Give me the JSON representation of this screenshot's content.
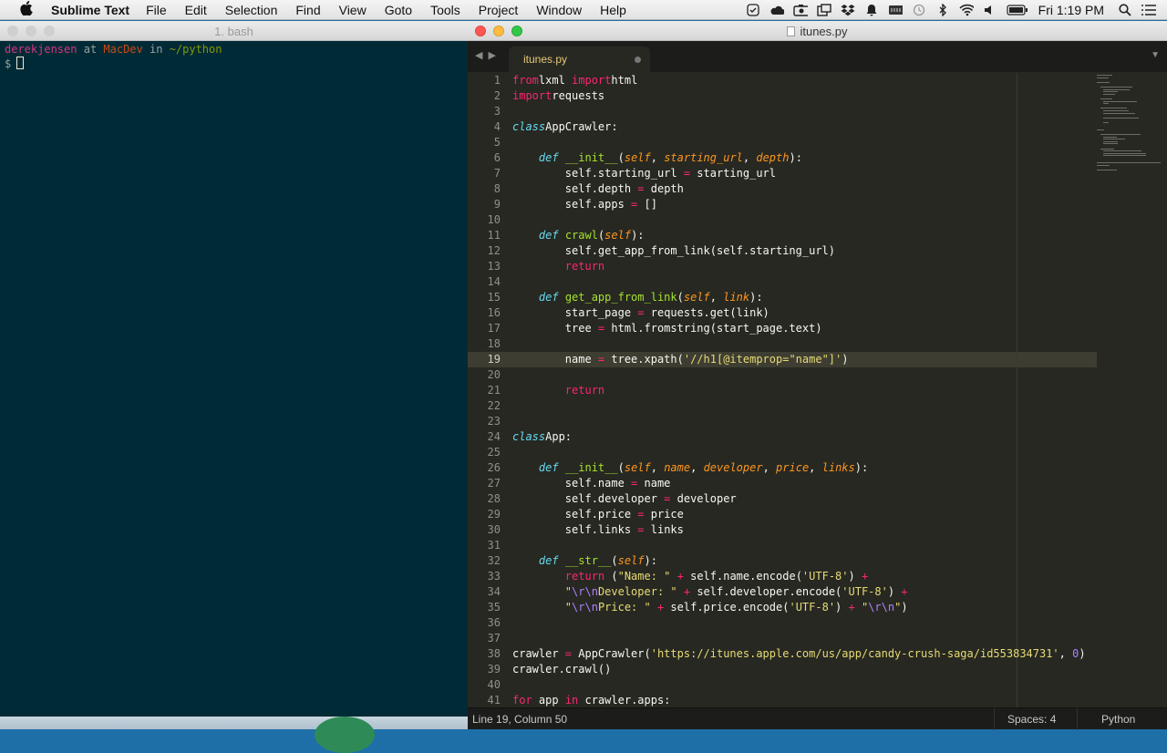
{
  "menubar": {
    "app_name": "Sublime Text",
    "items": [
      "File",
      "Edit",
      "Selection",
      "Find",
      "View",
      "Goto",
      "Tools",
      "Project",
      "Window",
      "Help"
    ],
    "clock": "Fri 1:19 PM",
    "status_icons": [
      "check-circle-icon",
      "cloud-icon",
      "camera-icon",
      "window-icon",
      "dropbox-icon",
      "bell-icon",
      "keyboard-icon",
      "time-machine-icon",
      "bluetooth-icon",
      "wifi-icon",
      "volume-icon",
      "battery-icon",
      "search-icon",
      "list-icon"
    ]
  },
  "terminal": {
    "title": "1. bash",
    "user": "derekjensen",
    "at": "at",
    "host": "MacDev",
    "in": "in",
    "path": "~/python",
    "prompt": "$"
  },
  "sublime": {
    "window_title": "itunes.py",
    "tab_label": "itunes.py",
    "active_line": 19,
    "line_count": 41,
    "status": {
      "position": "Line 19, Column 50",
      "spaces": "Spaces: 4",
      "syntax": "Python"
    },
    "code": [
      [
        [
          "kw",
          "from"
        ],
        [
          "",
          "lxml "
        ],
        [
          "kw",
          "import"
        ],
        [
          "",
          "html"
        ]
      ],
      [
        [
          "kw",
          "import"
        ],
        [
          "",
          "requests"
        ]
      ],
      [],
      [
        [
          "st",
          "class"
        ],
        [
          "",
          "AppCrawler:"
        ]
      ],
      [],
      [
        [
          "",
          "    "
        ],
        [
          "st",
          "def"
        ],
        [
          "",
          ""
        ],
        [
          "fn",
          "__init__"
        ],
        [
          "",
          "("
        ],
        [
          "pa",
          "self"
        ],
        [
          "",
          ", "
        ],
        [
          "pa",
          "starting_url"
        ],
        [
          "",
          ", "
        ],
        [
          "pa",
          "depth"
        ],
        [
          "",
          "):"
        ]
      ],
      [
        [
          "",
          "        self.starting_url "
        ],
        [
          "op",
          "="
        ],
        [
          "",
          " starting_url"
        ]
      ],
      [
        [
          "",
          "        self.depth "
        ],
        [
          "op",
          "="
        ],
        [
          "",
          " depth"
        ]
      ],
      [
        [
          "",
          "        self.apps "
        ],
        [
          "op",
          "="
        ],
        [
          "",
          " []"
        ]
      ],
      [],
      [
        [
          "",
          "    "
        ],
        [
          "st",
          "def"
        ],
        [
          "",
          ""
        ],
        [
          "fn",
          "crawl"
        ],
        [
          "",
          "("
        ],
        [
          "pa",
          "self"
        ],
        [
          "",
          "):"
        ]
      ],
      [
        [
          "",
          "        self.get_app_from_link(self.starting_url)"
        ]
      ],
      [
        [
          "",
          "        "
        ],
        [
          "kw",
          "return"
        ]
      ],
      [],
      [
        [
          "",
          "    "
        ],
        [
          "st",
          "def"
        ],
        [
          "",
          ""
        ],
        [
          "fn",
          "get_app_from_link"
        ],
        [
          "",
          "("
        ],
        [
          "pa",
          "self"
        ],
        [
          "",
          ", "
        ],
        [
          "pa",
          "link"
        ],
        [
          "",
          "):"
        ]
      ],
      [
        [
          "",
          "        start_page "
        ],
        [
          "op",
          "="
        ],
        [
          "",
          " requests.get(link)"
        ]
      ],
      [
        [
          "",
          "        tree "
        ],
        [
          "op",
          "="
        ],
        [
          "",
          " html.fromstring(start_page.text)"
        ]
      ],
      [],
      [
        [
          "",
          "        name "
        ],
        [
          "op",
          "="
        ],
        [
          "",
          " tree.xpath("
        ],
        [
          "str",
          "'//h1[@itemprop=\"name\"]'"
        ],
        [
          "",
          ")"
        ]
      ],
      [],
      [
        [
          "",
          "        "
        ],
        [
          "kw",
          "return"
        ]
      ],
      [],
      [],
      [
        [
          "st",
          "class"
        ],
        [
          "",
          "App:"
        ]
      ],
      [],
      [
        [
          "",
          "    "
        ],
        [
          "st",
          "def"
        ],
        [
          "",
          ""
        ],
        [
          "fn",
          "__init__"
        ],
        [
          "",
          "("
        ],
        [
          "pa",
          "self"
        ],
        [
          "",
          ", "
        ],
        [
          "pa",
          "name"
        ],
        [
          "",
          ", "
        ],
        [
          "pa",
          "developer"
        ],
        [
          "",
          ", "
        ],
        [
          "pa",
          "price"
        ],
        [
          "",
          ", "
        ],
        [
          "pa",
          "links"
        ],
        [
          "",
          "):"
        ]
      ],
      [
        [
          "",
          "        self.name "
        ],
        [
          "op",
          "="
        ],
        [
          "",
          " name"
        ]
      ],
      [
        [
          "",
          "        self.developer "
        ],
        [
          "op",
          "="
        ],
        [
          "",
          " developer"
        ]
      ],
      [
        [
          "",
          "        self.price "
        ],
        [
          "op",
          "="
        ],
        [
          "",
          " price"
        ]
      ],
      [
        [
          "",
          "        self.links "
        ],
        [
          "op",
          "="
        ],
        [
          "",
          " links"
        ]
      ],
      [],
      [
        [
          "",
          "    "
        ],
        [
          "st",
          "def"
        ],
        [
          "",
          ""
        ],
        [
          "fn",
          "__str__"
        ],
        [
          "",
          "("
        ],
        [
          "pa",
          "self"
        ],
        [
          "",
          "):"
        ]
      ],
      [
        [
          "",
          "        "
        ],
        [
          "kw",
          "return"
        ],
        [
          "",
          " ("
        ],
        [
          "str",
          "\"Name: \""
        ],
        [
          "op",
          " + "
        ],
        [
          "",
          "self.name.encode("
        ],
        [
          "str",
          "'UTF-8'"
        ],
        [
          "",
          ") "
        ],
        [
          "op",
          "+"
        ]
      ],
      [
        [
          "",
          "        "
        ],
        [
          "str",
          "\""
        ],
        [
          "se",
          "\\r\\n"
        ],
        [
          "str",
          "Developer: \""
        ],
        [
          "op",
          " + "
        ],
        [
          "",
          "self.developer.encode("
        ],
        [
          "str",
          "'UTF-8'"
        ],
        [
          "",
          ") "
        ],
        [
          "op",
          "+"
        ]
      ],
      [
        [
          "",
          "        "
        ],
        [
          "str",
          "\""
        ],
        [
          "se",
          "\\r\\n"
        ],
        [
          "str",
          "Price: \""
        ],
        [
          "op",
          " + "
        ],
        [
          "",
          "self.price.encode("
        ],
        [
          "str",
          "'UTF-8'"
        ],
        [
          "",
          ") "
        ],
        [
          "op",
          "+"
        ],
        [
          "",
          " "
        ],
        [
          "str",
          "\""
        ],
        [
          "se",
          "\\r\\n"
        ],
        [
          "str",
          "\""
        ],
        [
          "",
          ")"
        ]
      ],
      [],
      [],
      [
        [
          "",
          "crawler "
        ],
        [
          "op",
          "="
        ],
        [
          "",
          " AppCrawler("
        ],
        [
          "str",
          "'https://itunes.apple.com/us/app/candy-crush-saga/id553834731'"
        ],
        [
          "",
          ", "
        ],
        [
          "nu",
          "0"
        ],
        [
          "",
          ")"
        ]
      ],
      [
        [
          "",
          "crawler.crawl()"
        ]
      ],
      [],
      [
        [
          "kw",
          "for"
        ],
        [
          "",
          " app "
        ],
        [
          "kw",
          "in"
        ],
        [
          "",
          " crawler.apps:"
        ]
      ]
    ]
  }
}
